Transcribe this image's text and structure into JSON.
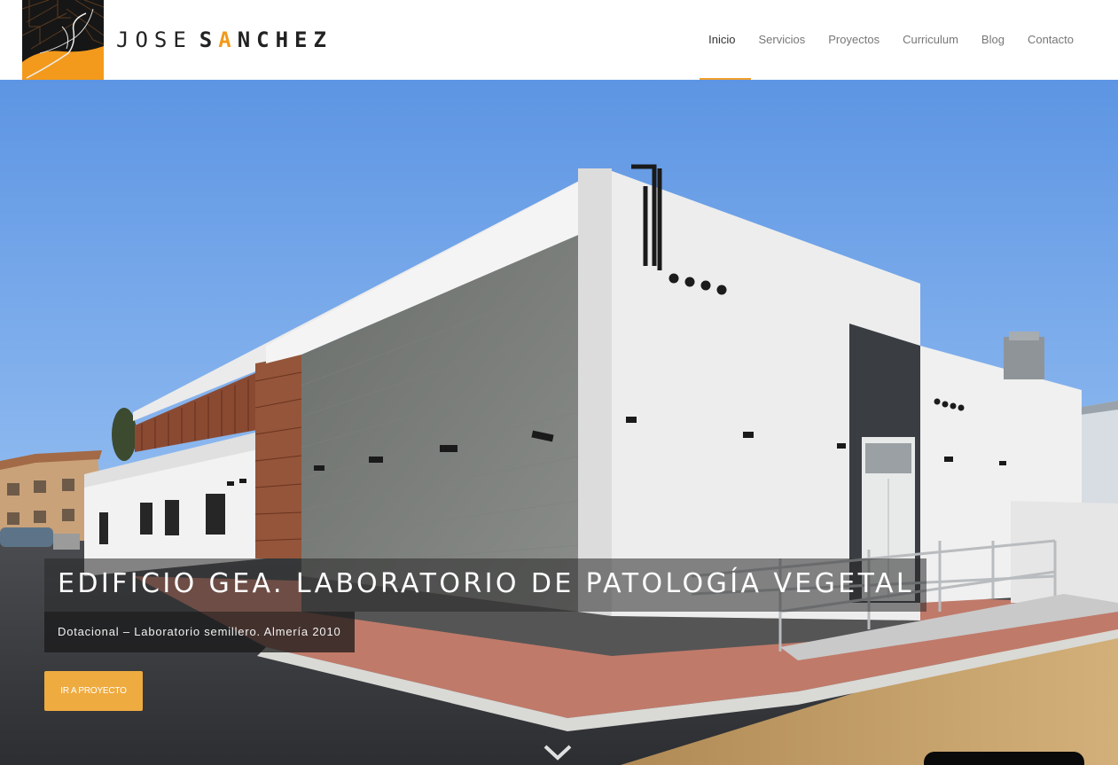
{
  "brand": {
    "first_name": "JOSE",
    "last_name_pre": "S",
    "last_name_accent": "A",
    "last_name_post": "NCHEZ",
    "accent_color": "#f19a1a"
  },
  "nav": {
    "items": [
      {
        "label": "Inicio",
        "active": true
      },
      {
        "label": "Servicios"
      },
      {
        "label": "Proyectos"
      },
      {
        "label": "Curriculum"
      },
      {
        "label": "Blog"
      },
      {
        "label": "Contacto"
      }
    ],
    "active_color": "#f0a030"
  },
  "hero": {
    "title": "EDIFICIO GEA. LABORATORIO DE PATOLOGÍA VEGETAL",
    "subtitle": "Dotacional – Laboratorio semillero. Almería 2010",
    "cta_label": "IR A PROYECTO",
    "cta_color": "#eeab40",
    "scroll_icon": "chevron-down-icon"
  }
}
